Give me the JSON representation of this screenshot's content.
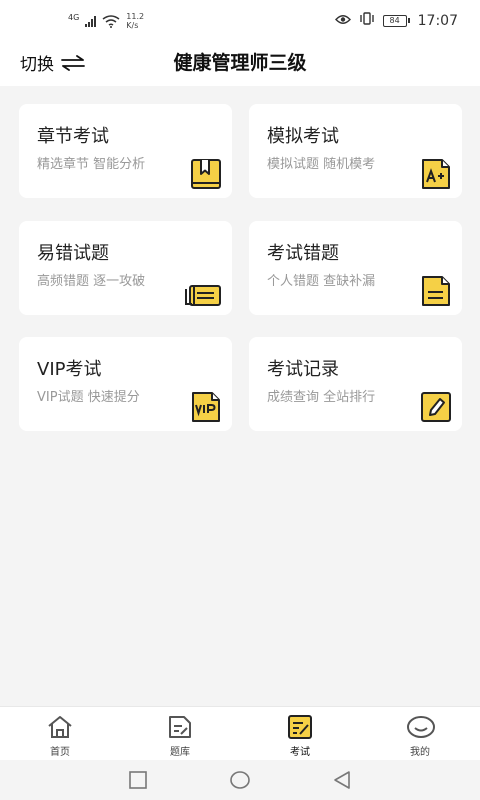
{
  "status_bar": {
    "network": "4G",
    "speed_value": "11.2",
    "speed_unit": "K/s",
    "battery": "84",
    "time": "17:07"
  },
  "header": {
    "switch_label": "切换",
    "title": "健康管理师三级"
  },
  "cards": [
    {
      "title": "章节考试",
      "subtitle": "精选章节 智能分析",
      "icon": "bookmark-book-icon"
    },
    {
      "title": "模拟考试",
      "subtitle": "模拟试题 随机模考",
      "icon": "a-plus-doc-icon"
    },
    {
      "title": "易错试题",
      "subtitle": "高频错题 逐一攻破",
      "icon": "ticket-icon"
    },
    {
      "title": "考试错题",
      "subtitle": "个人错题 查缺补漏",
      "icon": "list-doc-icon"
    },
    {
      "title": "VIP考试",
      "subtitle": "VIP试题 快速提分",
      "icon": "vip-doc-icon"
    },
    {
      "title": "考试记录",
      "subtitle": "成绩查询 全站排行",
      "icon": "pencil-note-icon"
    }
  ],
  "tabs": [
    {
      "label": "首页",
      "icon": "home-icon"
    },
    {
      "label": "题库",
      "icon": "question-bank-icon"
    },
    {
      "label": "考试",
      "icon": "exam-icon",
      "active": true
    },
    {
      "label": "我的",
      "icon": "profile-icon"
    }
  ],
  "colors": {
    "accent": "#f5d046",
    "background": "#f4f4f4",
    "card": "#ffffff",
    "subtitle": "#999999"
  }
}
